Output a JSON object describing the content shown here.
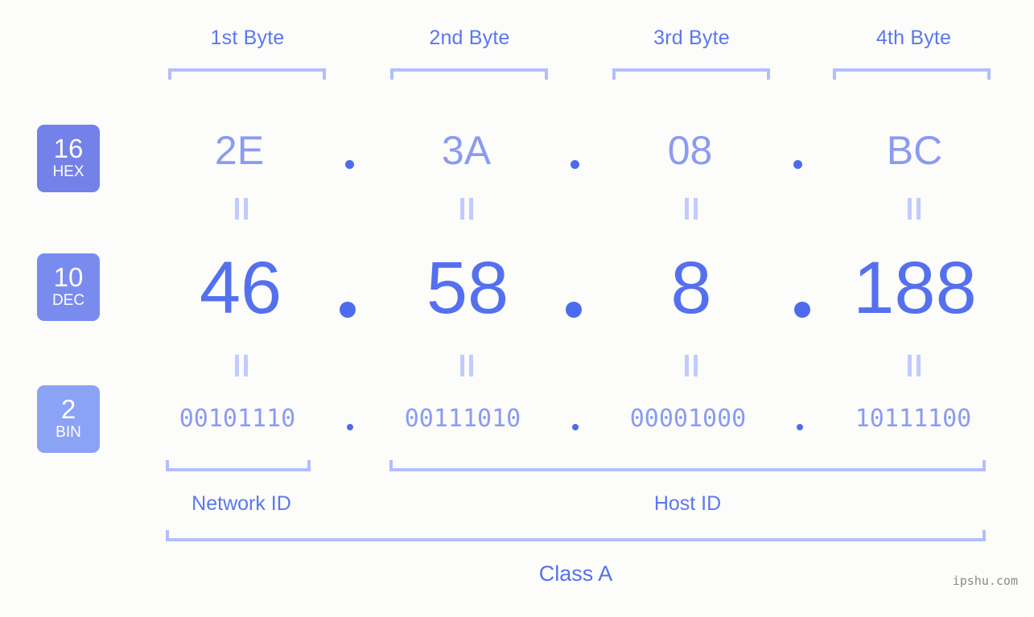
{
  "background_color": "#fcfdfa",
  "accent_color": "#5570ef",
  "bracket_color": "#b3befc",
  "byte_headers": [
    {
      "label": "1st Byte"
    },
    {
      "label": "2nd Byte"
    },
    {
      "label": "3rd Byte"
    },
    {
      "label": "4th Byte"
    }
  ],
  "bases": [
    {
      "num": "16",
      "name": "HEX",
      "color": "#7481e8"
    },
    {
      "num": "10",
      "name": "DEC",
      "color": "#7a8bf0"
    },
    {
      "num": "2",
      "name": "BIN",
      "color": "#8ba3f5"
    }
  ],
  "rows": {
    "hex": {
      "values": [
        "2E",
        "3A",
        "08",
        "BC"
      ],
      "separator": "."
    },
    "dec": {
      "values": [
        "46",
        "58",
        "8",
        "188"
      ],
      "separator": "."
    },
    "bin": {
      "values": [
        "00101110",
        "00111010",
        "00001000",
        "10111100"
      ],
      "separator": "."
    }
  },
  "equals_symbol": "=",
  "segments": {
    "network_id": "Network ID",
    "host_id": "Host ID"
  },
  "class_label": "Class A",
  "watermark": "ipshu.com"
}
